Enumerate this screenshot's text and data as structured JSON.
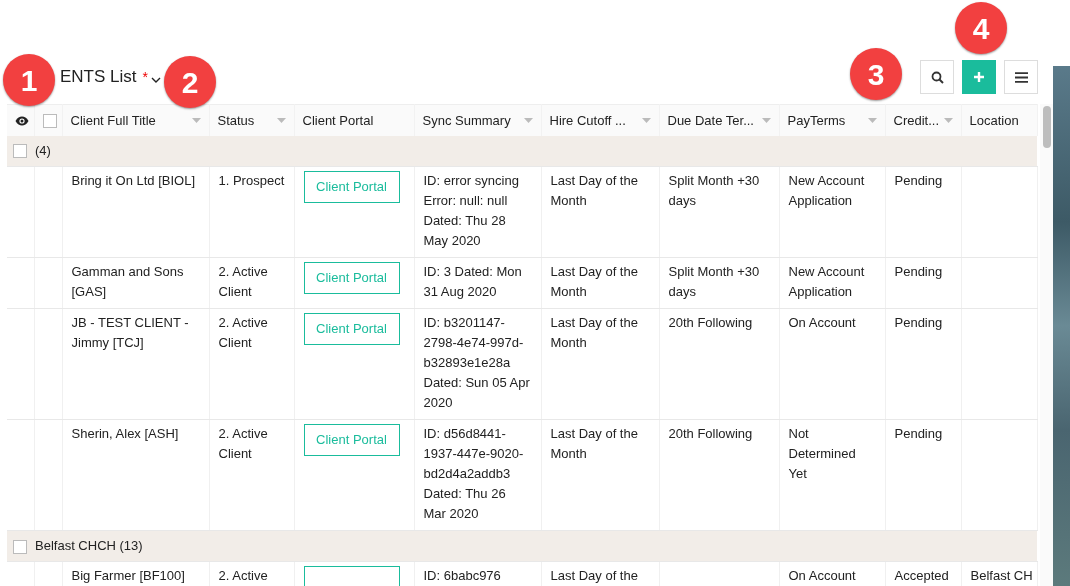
{
  "header": {
    "title": "ENTS List",
    "required_mark": "*"
  },
  "callouts": [
    {
      "label": "1"
    },
    {
      "label": "2"
    },
    {
      "label": "3"
    },
    {
      "label": "4"
    }
  ],
  "columns": [
    {
      "kind": "eye"
    },
    {
      "kind": "check",
      "checked": false
    },
    {
      "kind": "text",
      "label": "Client Full Title",
      "sortable": true
    },
    {
      "kind": "text",
      "label": "Status",
      "sortable": true
    },
    {
      "kind": "text",
      "label": "Client Portal",
      "sortable": false
    },
    {
      "kind": "text",
      "label": "Sync Summary",
      "sortable": true
    },
    {
      "kind": "text",
      "label": "Hire Cutoff ...",
      "sortable": true
    },
    {
      "kind": "text",
      "label": "Due Date Ter...",
      "sortable": true
    },
    {
      "kind": "text",
      "label": "PayTerms",
      "sortable": true
    },
    {
      "kind": "text",
      "label": "Credit...",
      "sortable": true
    },
    {
      "kind": "text",
      "label": "Location",
      "sortable": false
    }
  ],
  "groups": [
    {
      "label": "(4)",
      "checked": false,
      "rows": [
        {
          "title": "Bring it On Ltd [BIOL]",
          "status": "1. Prospect",
          "portal": "Client Portal",
          "sync": "ID: error syncing Error: null: null Dated: Thu 28 May 2020",
          "hire_cutoff": "Last Day of the Month",
          "due_date": "Split Month +30 days",
          "payterms": "New Account Application",
          "credit": "Pending"
        },
        {
          "title": "Gamman and Sons [GAS]",
          "status": "2. Active Client",
          "portal": "Client Portal",
          "sync": "ID: 3 Dated: Mon 31 Aug 2020",
          "hire_cutoff": "Last Day of the Month",
          "due_date": "Split Month +30 days",
          "payterms": "New Account Application",
          "credit": "Pending"
        },
        {
          "title": "JB - TEST CLIENT - Jimmy [TCJ]",
          "status": "2. Active Client",
          "portal": "Client Portal",
          "sync": "ID: b3201147-2798-4e74-997d-b32893e1e28a Dated: Sun 05 Apr 2020",
          "hire_cutoff": "Last Day of the Month",
          "due_date": "20th Following",
          "payterms": "On Account",
          "credit": "Pending"
        },
        {
          "title": "Sherin, Alex [ASH]",
          "status": "2. Active Client",
          "portal": "Client Portal",
          "sync": "ID: d56d8441-1937-447e-9020-bd2d4a2addb3 Dated: Thu 26 Mar 2020",
          "hire_cutoff": "Last Day of the Month",
          "due_date": "20th Following",
          "payterms": "Not Determined Yet",
          "credit": "Pending"
        }
      ]
    },
    {
      "label": "Belfast CHCH (13)",
      "checked": false,
      "rows": [
        {
          "title": "Big Farmer [BF100]",
          "status": "2. Active",
          "sync": "ID: 6babc976",
          "hire_cutoff": "Last Day of the",
          "payterms": "On Account",
          "credit": "Accepted",
          "location": "Belfast CH"
        }
      ]
    }
  ]
}
